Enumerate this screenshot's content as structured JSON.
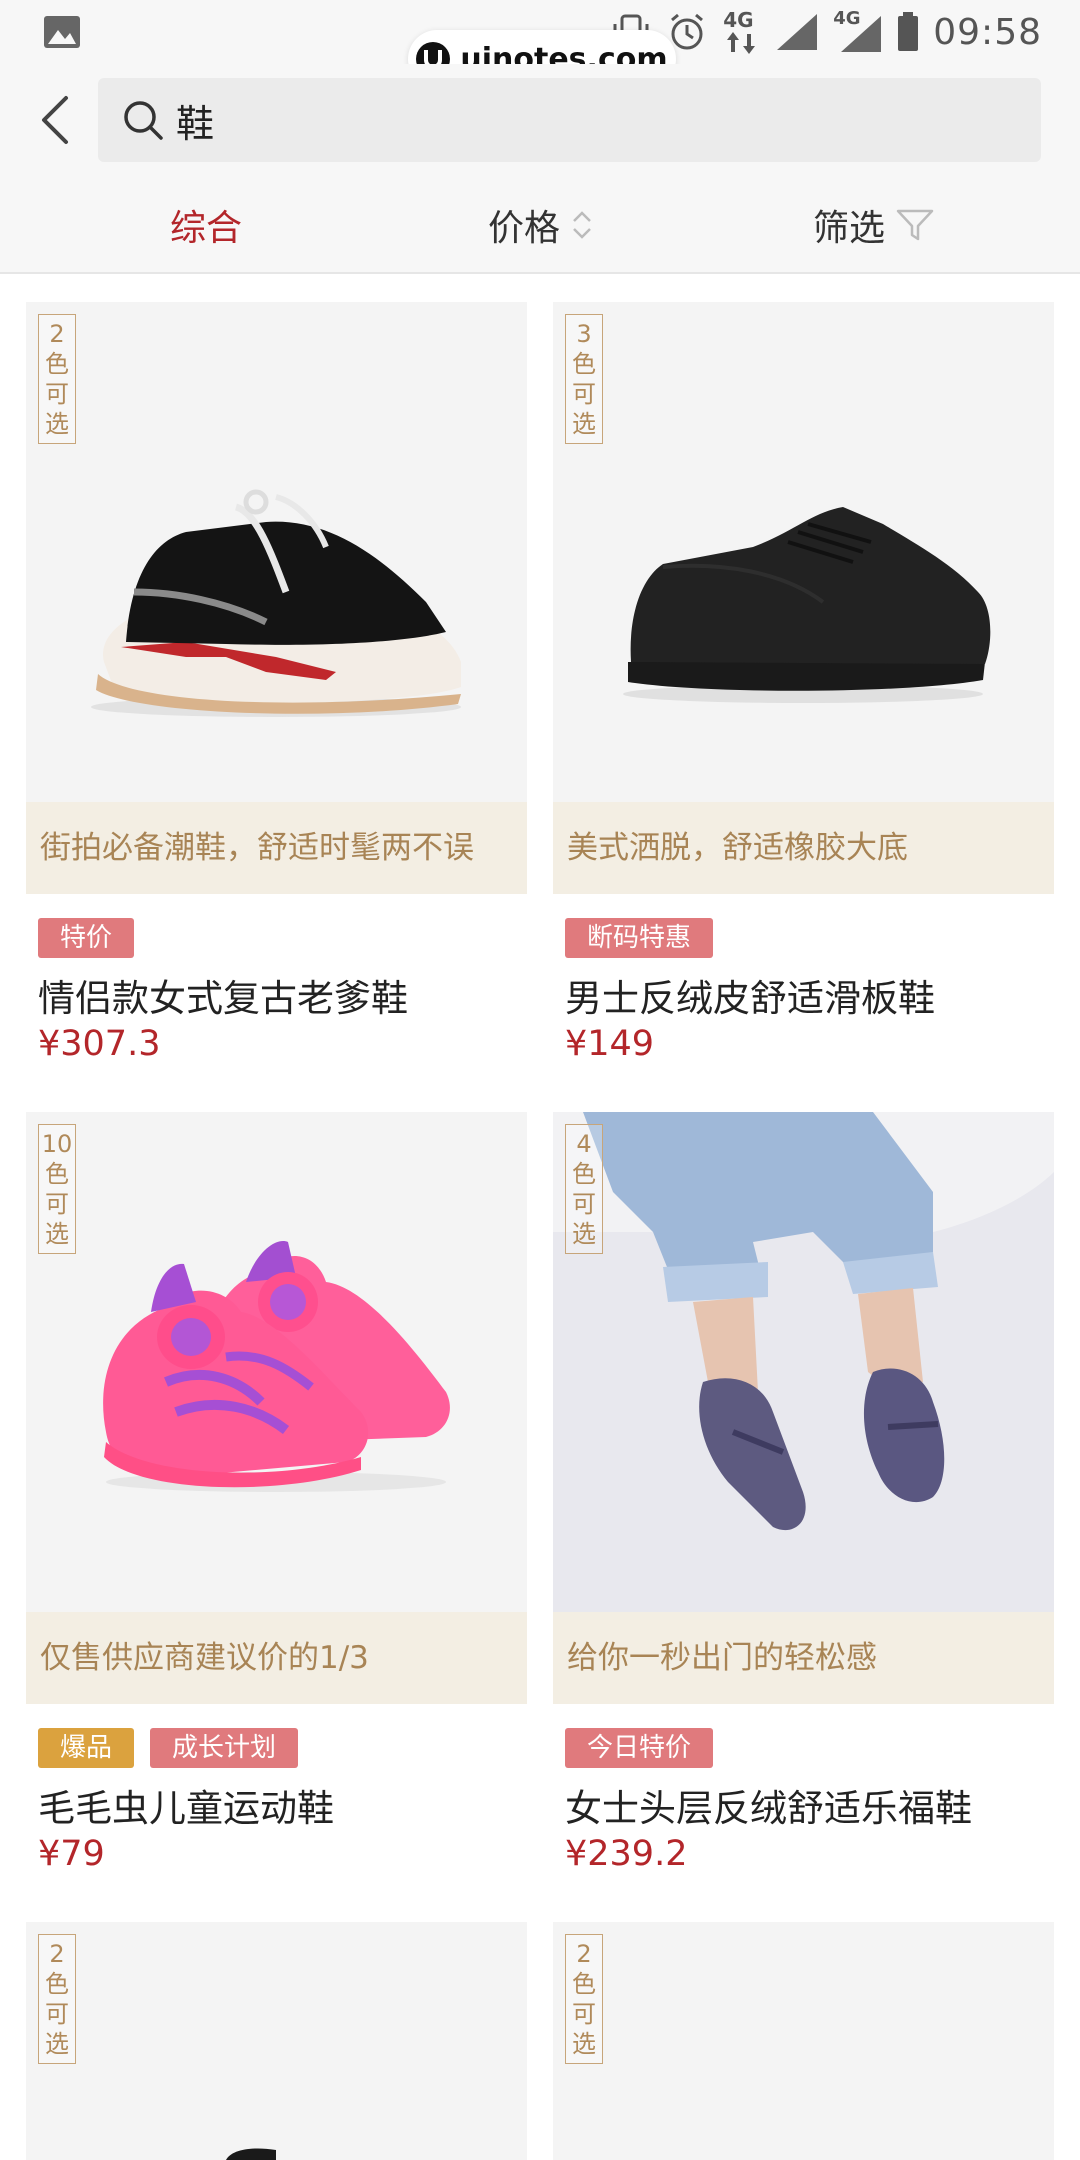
{
  "status_bar": {
    "time": "09:58",
    "network_1": "4G",
    "network_2": "4G",
    "icons": [
      "image-icon",
      "vibrate-icon",
      "alarm-icon",
      "data-arrows-icon",
      "signal-icon",
      "signal-icon",
      "battery-icon"
    ]
  },
  "watermark": {
    "text": "uinotes.com"
  },
  "search": {
    "query": "鞋"
  },
  "sort_tabs": [
    {
      "label": "综合",
      "active": true
    },
    {
      "label": "价格",
      "icon": "sort-updown-icon"
    },
    {
      "label": "筛选",
      "icon": "filter-funnel-icon"
    }
  ],
  "colors": {
    "accent": "#b3262a",
    "badge_red": "#e07a7d",
    "badge_gold": "#dba23e",
    "slogan_bg": "#f3eee3",
    "slogan_text": "#a88455"
  },
  "products": [
    {
      "color_tag": "2色可选",
      "slogan": "街拍必备潮鞋，舒适时髦两不误",
      "badges": [
        {
          "label": "特价",
          "style": "red"
        }
      ],
      "name": "情侣款女式复古老爹鞋",
      "price": "¥307.3",
      "image": "black-white-chunky-sneaker"
    },
    {
      "color_tag": "3色可选",
      "slogan": "美式洒脱，舒适橡胶大底",
      "badges": [
        {
          "label": "断码特惠",
          "style": "red"
        }
      ],
      "name": "男士反绒皮舒适滑板鞋",
      "price": "¥149",
      "image": "black-suede-skate-shoe"
    },
    {
      "color_tag": "10色可选",
      "slogan": "仅售供应商建议价的1/3",
      "badges": [
        {
          "label": "爆品",
          "style": "gold"
        },
        {
          "label": "成长计划",
          "style": "red"
        }
      ],
      "name": "毛毛虫儿童运动鞋",
      "price": "¥79",
      "image": "pink-purple-kids-caterpillar-shoes"
    },
    {
      "color_tag": "4色可选",
      "slogan": "给你一秒出门的轻松感",
      "badges": [
        {
          "label": "今日特价",
          "style": "red"
        }
      ],
      "name": "女士头层反绒舒适乐福鞋",
      "price": "¥239.2",
      "image": "purple-suede-loafers-on-model"
    },
    {
      "color_tag": "2色可选",
      "image": "shoe-partial"
    },
    {
      "color_tag": "2色可选",
      "image": "shoe-partial"
    }
  ]
}
